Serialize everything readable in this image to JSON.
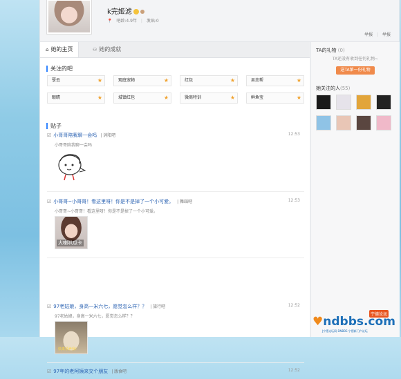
{
  "header": {
    "username": "k完姬滤",
    "age_label": "吧龄:4.9年",
    "posts_label": "发贴:0",
    "links": [
      "举报",
      "举报"
    ]
  },
  "tabs": [
    {
      "label": "她的主页",
      "icon": "home-icon"
    },
    {
      "label": "她的成就",
      "icon": "person-icon"
    }
  ],
  "followed_section_title": "关注的吧",
  "forums": [
    "孽云",
    "观庭宠物",
    "红包",
    "吴忠帮",
    "眼睛",
    "城镇红包",
    "微商特训",
    "鲜鱼宝"
  ],
  "posts_section_title": "贴子",
  "posts": [
    {
      "title": "小哥哥陪我聊一会吗",
      "forum": "消阳吧",
      "time": "12:53",
      "summary": "小哥哥陪我聊一会吗",
      "image": "cartoon"
    },
    {
      "title": "小哥哥~小哥哥！看这里呀！你是不是掉了一个小可爱。",
      "forum": "舞蹈吧",
      "time": "12:53",
      "summary": "小哥哥~小哥哥！看这里呀！你是不是掉了一个小可爱。",
      "image": "girl",
      "image_caption": "大喇叭瓜卡"
    },
    {
      "title": "97老姑娘，身高一米六七，愿觉怎么样？？",
      "forum": "旅行吧",
      "time": "12:52",
      "summary": "97老姑娘，身高一米六七，愿觉怎么样？？",
      "image": "cat",
      "image_caption": "快来领养我!"
    },
    {
      "title": "97年的老阿姨来交个朋友",
      "forum": "版食吧",
      "time": "12:52"
    }
  ],
  "gifts": {
    "title": "TA的礼物",
    "count": "(0)",
    "note": "TA还没有收到任何礼物~",
    "button": "送TA第一份礼物"
  },
  "followed_people": {
    "title": "她关注的人",
    "count": "(55)"
  },
  "logo": {
    "main": "ndbbs.com",
    "tag": "宁德论坛",
    "sub": "J宁德论坛网  DNBBS 宁德新门户论坛"
  },
  "colors": {
    "link": "#2d64b3",
    "accent": "#3385ff",
    "gift_button": "#f08a4b",
    "star": "#f0a22e"
  }
}
